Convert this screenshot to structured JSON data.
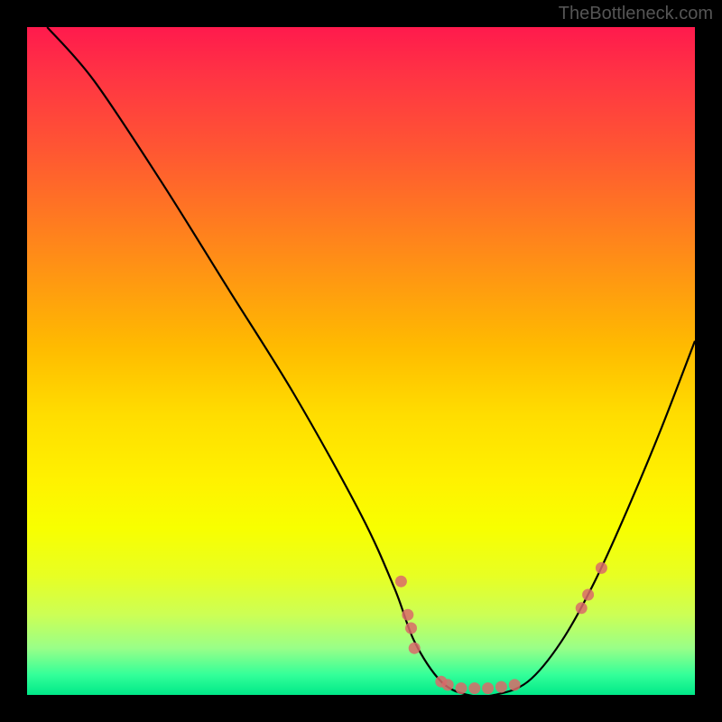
{
  "watermark": "TheBottleneck.com",
  "chart_data": {
    "type": "line",
    "title": "",
    "xlabel": "",
    "ylabel": "",
    "xlim": [
      0,
      100
    ],
    "ylim": [
      0,
      100
    ],
    "series": [
      {
        "name": "bottleneck-curve",
        "x": [
          3,
          10,
          20,
          30,
          40,
          50,
          55,
          58,
          62,
          66,
          70,
          75,
          80,
          85,
          90,
          95,
          100
        ],
        "y": [
          100,
          92,
          77,
          61,
          45,
          27,
          16,
          8,
          2,
          0,
          0,
          2,
          8,
          17,
          28,
          40,
          53
        ]
      }
    ],
    "markers": {
      "name": "data-points",
      "color": "#d96a6a",
      "points": [
        {
          "x": 56,
          "y": 17
        },
        {
          "x": 57,
          "y": 12
        },
        {
          "x": 57.5,
          "y": 10
        },
        {
          "x": 58,
          "y": 7
        },
        {
          "x": 62,
          "y": 2
        },
        {
          "x": 63,
          "y": 1.5
        },
        {
          "x": 65,
          "y": 1
        },
        {
          "x": 67,
          "y": 1
        },
        {
          "x": 69,
          "y": 1
        },
        {
          "x": 71,
          "y": 1.2
        },
        {
          "x": 73,
          "y": 1.5
        },
        {
          "x": 83,
          "y": 13
        },
        {
          "x": 84,
          "y": 15
        },
        {
          "x": 86,
          "y": 19
        }
      ]
    }
  }
}
